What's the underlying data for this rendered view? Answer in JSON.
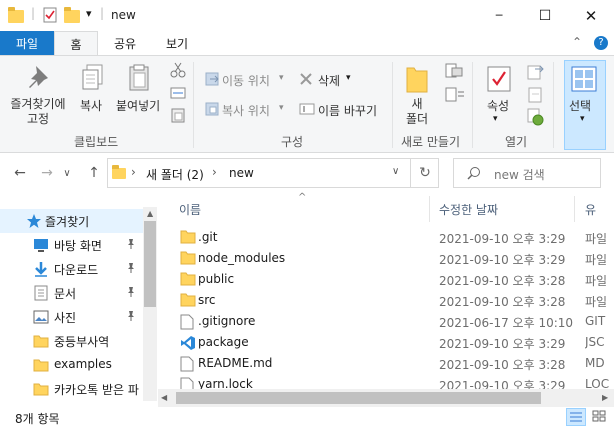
{
  "window": {
    "title": "new",
    "minimize_glyph": "─",
    "maximize_glyph": "☐",
    "close_glyph": "✕"
  },
  "quick_access": {
    "dropdown_glyph": "▾",
    "separator": "|"
  },
  "tabs": [
    {
      "label": "파일"
    },
    {
      "label": "홈"
    },
    {
      "label": "공유"
    },
    {
      "label": "보기"
    }
  ],
  "ribbon_controls": {
    "collapse_glyph": "⌃",
    "help_glyph": "?"
  },
  "ribbon": {
    "pin_quick": "즐겨찾기에\n고정",
    "pin_quick_line1": "즐겨찾기에",
    "pin_quick_line2": "고정",
    "copy": "복사",
    "paste": "붙여넣기",
    "clipboard_group": "클립보드",
    "move_to": "이동 위치",
    "copy_to": "복사 위치",
    "delete": "삭제",
    "rename": "이름 바꾸기",
    "organize_group": "구성",
    "new_folder_line1": "새",
    "new_folder_line2": "폴더",
    "new_group": "새로 만들기",
    "properties": "속성",
    "open_group": "열기",
    "select": "선택"
  },
  "address": {
    "path_sep": "›",
    "crumbs": [
      "새 폴더 (2)",
      "new"
    ],
    "refresh_glyph": "↻",
    "dropdown_glyph": "∨"
  },
  "nav_buttons": {
    "back": "←",
    "forward": "→",
    "recent": "∨",
    "up": "↑"
  },
  "search": {
    "placeholder": "new 검색"
  },
  "nav_pane": {
    "items": [
      {
        "label": "즐겨찾기",
        "icon": "star-icon",
        "pinned": false
      },
      {
        "label": "바탕 화면",
        "icon": "desktop-icon",
        "pinned": true
      },
      {
        "label": "다운로드",
        "icon": "download-icon",
        "pinned": true
      },
      {
        "label": "문서",
        "icon": "document-icon",
        "pinned": true
      },
      {
        "label": "사진",
        "icon": "pictures-icon",
        "pinned": true
      },
      {
        "label": "중등부사역",
        "icon": "folder-icon",
        "pinned": false
      },
      {
        "label": "examples",
        "icon": "folder-icon",
        "pinned": false
      },
      {
        "label": "카카오톡 받은 파",
        "icon": "folder-icon",
        "pinned": false
      }
    ],
    "pin_glyph": "📌"
  },
  "columns": {
    "name": "이름",
    "modified": "수정한 날짜",
    "type": "유",
    "sort_glyph": "^"
  },
  "files": [
    {
      "name": ".git",
      "modified": "2021-09-10 오후 3:29",
      "type": "파일",
      "kind": "folder"
    },
    {
      "name": "node_modules",
      "modified": "2021-09-10 오후 3:29",
      "type": "파일",
      "kind": "folder"
    },
    {
      "name": "public",
      "modified": "2021-09-10 오후 3:28",
      "type": "파일",
      "kind": "folder"
    },
    {
      "name": "src",
      "modified": "2021-09-10 오후 3:28",
      "type": "파일",
      "kind": "folder"
    },
    {
      "name": ".gitignore",
      "modified": "2021-06-17 오후 10:10",
      "type": "GIT",
      "kind": "doc"
    },
    {
      "name": "package",
      "modified": "2021-09-10 오후 3:29",
      "type": "JSC",
      "kind": "vscode"
    },
    {
      "name": "README.md",
      "modified": "2021-09-10 오후 3:28",
      "type": "MD",
      "kind": "doc"
    },
    {
      "name": "yarn.lock",
      "modified": "2021-09-10 오후 3:29",
      "type": "LOC",
      "kind": "doc"
    }
  ],
  "status": {
    "count": "8개 항목"
  },
  "colors": {
    "accent": "#1979ca",
    "folder": "#ffd45e",
    "selection": "#cce8ff"
  }
}
